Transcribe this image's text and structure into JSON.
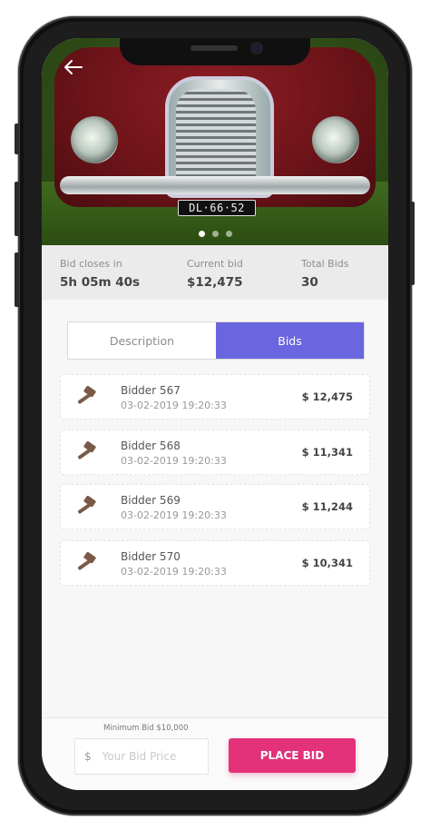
{
  "hero": {
    "plate_text": "DL·66·52",
    "carousel_dots": 3,
    "active_dot": 0
  },
  "stats": {
    "closes_label": "Bid closes in",
    "closes_value": "5h 05m 40s",
    "current_label": "Current bid",
    "current_value": "$12,475",
    "total_label": "Total Bids",
    "total_value": "30"
  },
  "tabs": {
    "description": "Description",
    "bids": "Bids",
    "active": "bids"
  },
  "bids": [
    {
      "name": "Bidder 567",
      "time": "03-02-2019 19:20:33",
      "amount": "$ 12,475"
    },
    {
      "name": "Bidder 568",
      "time": "03-02-2019 19:20:33",
      "amount": "$ 11,341"
    },
    {
      "name": "Bidder 569",
      "time": "03-02-2019 19:20:33",
      "amount": "$ 11,244"
    },
    {
      "name": "Bidder 570",
      "time": "03-02-2019 19:20:33",
      "amount": "$ 10,341"
    }
  ],
  "footer": {
    "min_bid": "Minimum Bid $10,000",
    "currency": "$",
    "placeholder": "Your Bid Price",
    "place_bid": "PLACE BID"
  },
  "colors": {
    "accent_tab": "#6a66df",
    "place_bid": "#e3317a",
    "gavel": "#7a5a47"
  },
  "icons": {
    "back": "arrow-left-icon",
    "bid": "gavel-icon"
  }
}
